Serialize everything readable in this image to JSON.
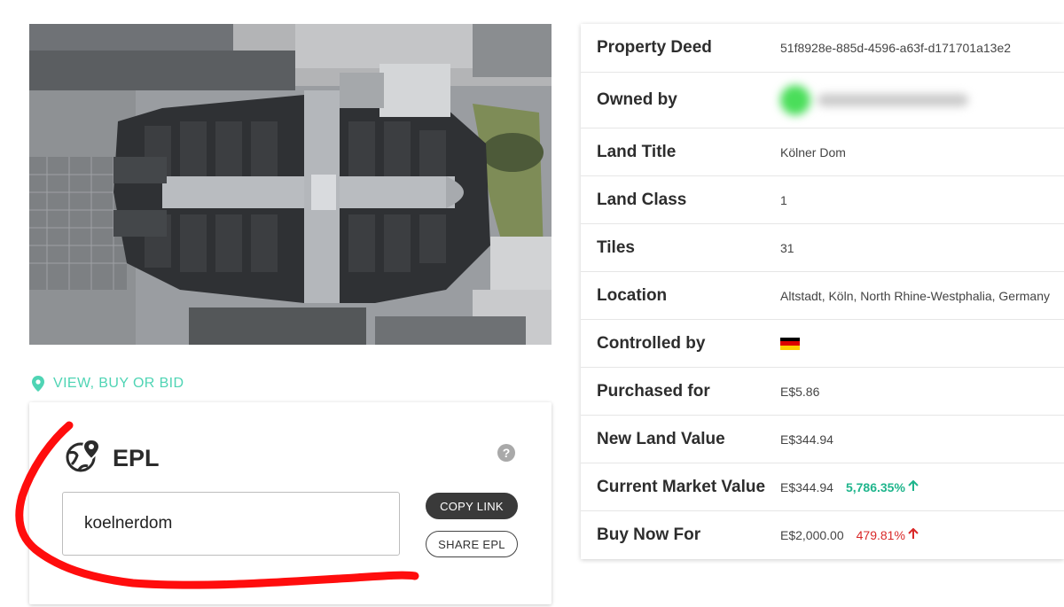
{
  "colors": {
    "accent": "#4fd4b4",
    "positive": "#1fb58c",
    "negative": "#d92828",
    "scribble": "#ff0000"
  },
  "aerial": {
    "description_icon": "aerial-photo"
  },
  "link": {
    "label": "VIEW, BUY OR BID",
    "icon": "map-pin-icon"
  },
  "epl": {
    "title": "EPL",
    "icon": "globe-pin-icon",
    "help": "?",
    "value": "koelnerdom",
    "copy_label": "COPY LINK",
    "share_label": "SHARE EPL"
  },
  "property": {
    "rows": [
      {
        "label": "Property Deed",
        "value": "51f8928e-885d-4596-a63f-d171701a13e2"
      },
      {
        "label": "Owned by",
        "value": ""
      },
      {
        "label": "Land Title",
        "value": "Kölner Dom"
      },
      {
        "label": "Land Class",
        "value": "1"
      },
      {
        "label": "Tiles",
        "value": "31"
      },
      {
        "label": "Location",
        "value": "Altstadt, Köln, North Rhine-Westphalia, Germany"
      },
      {
        "label": "Controlled by",
        "value": "",
        "flag": "germany-flag-icon"
      },
      {
        "label": "Purchased for",
        "value": "E$5.86"
      },
      {
        "label": "New Land Value",
        "value": "E$344.94"
      },
      {
        "label": "Current Market Value",
        "value": "E$344.94",
        "change": "5,786.35%",
        "change_icon": "arrow-up-icon"
      },
      {
        "label": "Buy Now For",
        "value": "E$2,000.00",
        "change": "479.81%",
        "change_icon": "arrow-up-icon"
      }
    ]
  }
}
